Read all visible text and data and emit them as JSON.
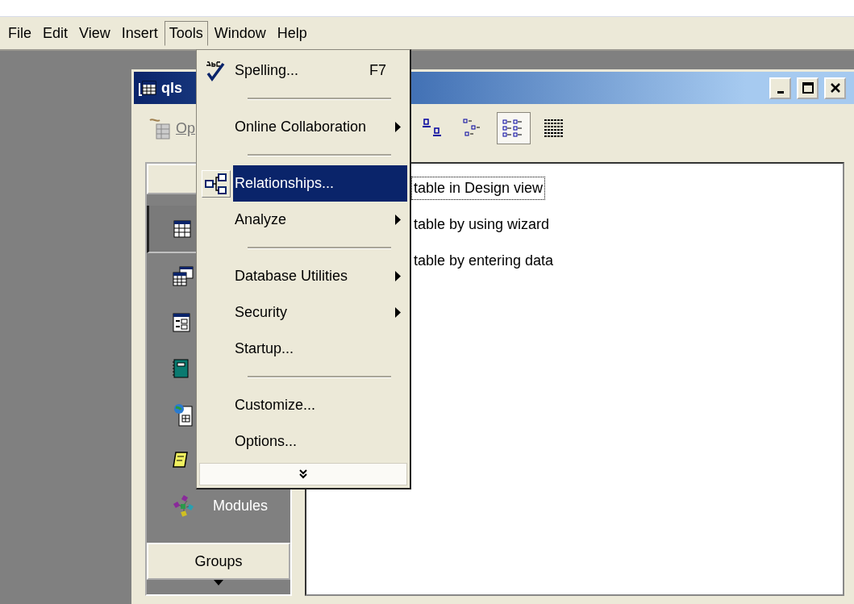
{
  "menu_bar": {
    "items": [
      {
        "label": "File",
        "selected": false
      },
      {
        "label": "Edit",
        "selected": false
      },
      {
        "label": "View",
        "selected": false
      },
      {
        "label": "Insert",
        "selected": false
      },
      {
        "label": "Tools",
        "selected": true
      },
      {
        "label": "Window",
        "selected": false
      },
      {
        "label": "Help",
        "selected": false
      }
    ]
  },
  "tools_menu": {
    "items": [
      {
        "kind": "item",
        "label": "Spelling...",
        "shortcut": "F7",
        "submenu": false,
        "selected": false
      },
      {
        "kind": "separator"
      },
      {
        "kind": "item",
        "label": "Online Collaboration",
        "submenu": true,
        "selected": false
      },
      {
        "kind": "separator"
      },
      {
        "kind": "item",
        "label": "Relationships...",
        "submenu": false,
        "selected": true
      },
      {
        "kind": "item",
        "label": "Analyze",
        "submenu": true,
        "selected": false
      },
      {
        "kind": "separator"
      },
      {
        "kind": "item",
        "label": "Database Utilities",
        "submenu": true,
        "selected": false
      },
      {
        "kind": "item",
        "label": "Security",
        "submenu": true,
        "selected": false
      },
      {
        "kind": "item",
        "label": "Startup...",
        "submenu": false,
        "selected": false
      },
      {
        "kind": "separator"
      },
      {
        "kind": "item",
        "label": "Customize...",
        "submenu": false,
        "selected": false
      },
      {
        "kind": "item",
        "label": "Options...",
        "submenu": false,
        "selected": false
      },
      {
        "kind": "expand"
      }
    ]
  },
  "database_window": {
    "title": "qls",
    "toolbar": {
      "open_label": "Op",
      "views": [
        {
          "selected": false
        },
        {
          "selected": false
        },
        {
          "selected": true
        },
        {
          "selected": false
        }
      ]
    },
    "objects_bar": {
      "items": [
        {
          "selected": true
        },
        {
          "selected": false
        },
        {
          "selected": false
        },
        {
          "selected": false
        },
        {
          "selected": false
        },
        {
          "selected": false
        },
        {
          "label": "Modules",
          "selected": false
        }
      ],
      "groups_button": "Groups"
    },
    "list": {
      "items": [
        {
          "label": "table in Design view",
          "focused": true
        },
        {
          "label": "table by using wizard",
          "focused": false
        },
        {
          "label": "table by entering data",
          "focused": false
        }
      ]
    }
  }
}
